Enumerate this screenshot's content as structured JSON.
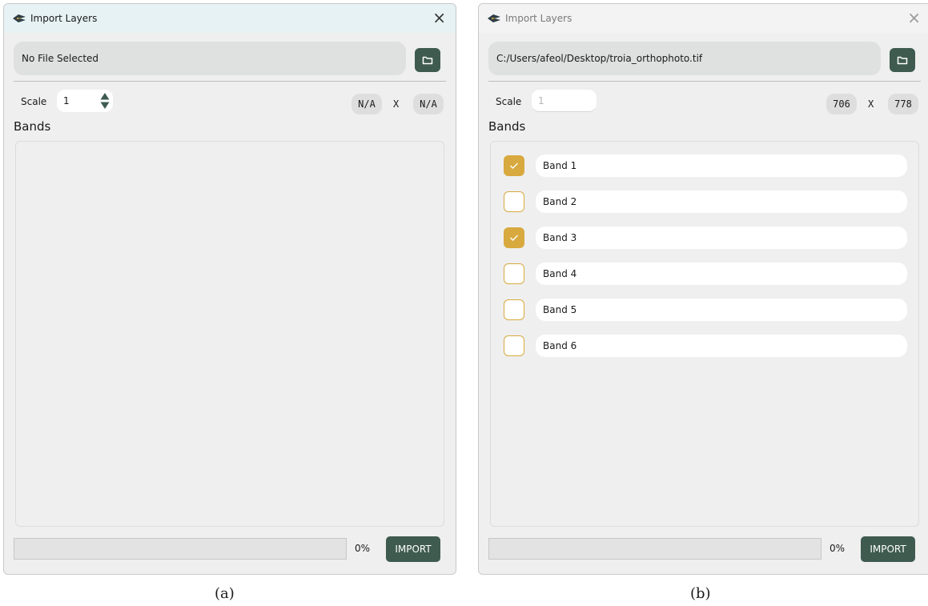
{
  "colors": {
    "accent": "#3f5b50",
    "check": "#d8a93e"
  },
  "window_a": {
    "title": "Import Layers",
    "file_path": "No File Selected",
    "scale_label": "Scale",
    "scale_value": "1",
    "width": "N/A",
    "times": "X",
    "height": "N/A",
    "bands_label": "Bands",
    "progress_text": "0%",
    "import_label": "IMPORT"
  },
  "window_b": {
    "title": "Import Layers",
    "file_path": "C:/Users/afeol/Desktop/troia_orthophoto.tif",
    "scale_label": "Scale",
    "scale_value": "1",
    "width": "706",
    "times": "X",
    "height": "778",
    "bands_label": "Bands",
    "bands": [
      {
        "name": "Band 1",
        "checked": true
      },
      {
        "name": "Band 2",
        "checked": false
      },
      {
        "name": "Band 3",
        "checked": true
      },
      {
        "name": "Band 4",
        "checked": false
      },
      {
        "name": "Band 5",
        "checked": false
      },
      {
        "name": "Band 6",
        "checked": false
      }
    ],
    "progress_text": "0%",
    "import_label": "IMPORT"
  },
  "captions": {
    "a": "(a)",
    "b": "(b)"
  }
}
